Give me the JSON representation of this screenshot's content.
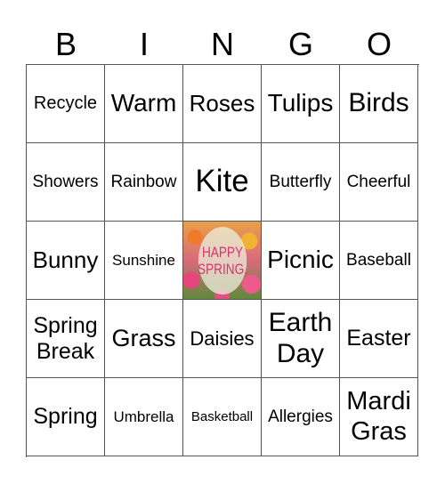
{
  "header": [
    "B",
    "I",
    "N",
    "G",
    "O"
  ],
  "cells": [
    [
      "Recycle",
      "Warm",
      "Roses",
      "Tulips",
      "Birds"
    ],
    [
      "Showers",
      "Rainbow",
      "Kite",
      "Butterfly",
      "Cheerful"
    ],
    [
      "Bunny",
      "Sunshine",
      "",
      "Picnic",
      "Baseball"
    ],
    [
      "Spring Break",
      "Grass",
      "Daisies",
      "Earth Day",
      "Easter"
    ],
    [
      "Spring",
      "Umbrella",
      "Basketball",
      "Allergies",
      "Mardi Gras"
    ]
  ],
  "free_space": {
    "line1": "HAPPY",
    "line2": "SPRING."
  }
}
